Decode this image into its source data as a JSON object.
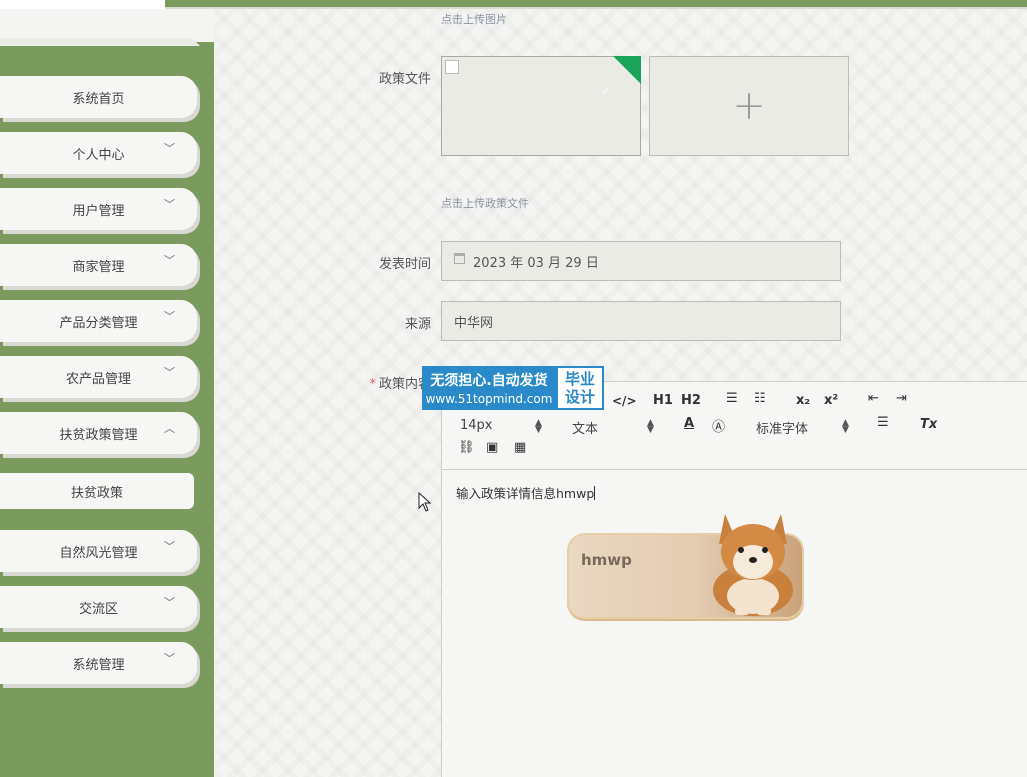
{
  "sidebar": {
    "items": [
      {
        "label": "系统首页",
        "expandable": false
      },
      {
        "label": "个人中心",
        "expandable": true
      },
      {
        "label": "用户管理",
        "expandable": true
      },
      {
        "label": "商家管理",
        "expandable": true
      },
      {
        "label": "产品分类管理",
        "expandable": true
      },
      {
        "label": "农产品管理",
        "expandable": true
      },
      {
        "label": "扶贫政策管理",
        "expandable": true,
        "expanded": true
      },
      {
        "label": "自然风光管理",
        "expandable": true
      },
      {
        "label": "交流区",
        "expandable": true
      },
      {
        "label": "系统管理",
        "expandable": true
      }
    ],
    "sub_item": "扶贫政策"
  },
  "form": {
    "image_hint": "点击上传图片",
    "file_label": "政策文件",
    "file_hint": "点击上传政策文件",
    "date_label": "发表时间",
    "date_value": "2023 年 03 月 29 日",
    "source_label": "来源",
    "source_value": "中华网",
    "content_label": "政策内容",
    "required_mark": "*"
  },
  "editor": {
    "toolbar": {
      "code": "</>",
      "h1": "H1",
      "h2": "H2",
      "subscript": "x₂",
      "superscript": "x²",
      "font_size": "14px",
      "paragraph": "文本",
      "font_family": "标准字体",
      "clear": "Tx"
    },
    "content": "输入政策详情信息hmwp",
    "sticker_text": "hmwp"
  },
  "watermark": {
    "line1": "无须担心.自动发货",
    "line2": "www.51topmind.com",
    "side1": "毕业",
    "side2": "设计"
  },
  "colors": {
    "sidebar": "#7a9a5e",
    "accent_green": "#19a45a",
    "watermark_blue": "#2a89c9"
  }
}
